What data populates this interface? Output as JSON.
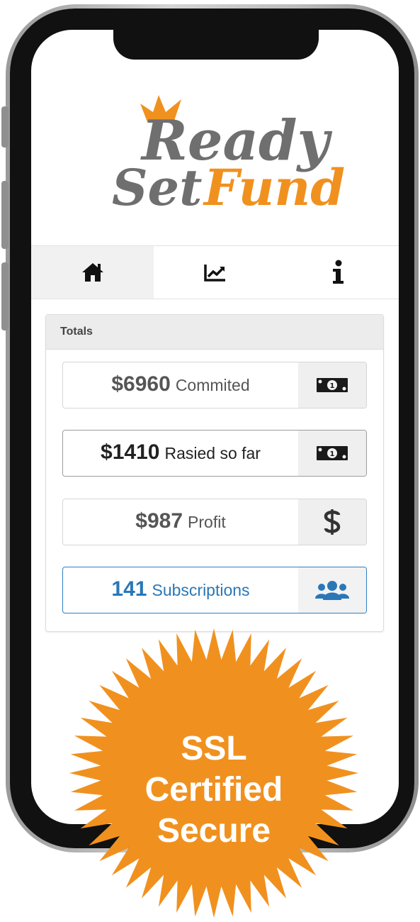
{
  "brand": {
    "word1": "Ready",
    "word2_a": "Set",
    "word2_b": "Fund",
    "accent_color": "#f0911f",
    "gray_color": "#6f6f6f"
  },
  "tabs": [
    {
      "icon": "home-icon",
      "active": true
    },
    {
      "icon": "chart-line-icon",
      "active": false
    },
    {
      "icon": "info-icon",
      "active": false
    }
  ],
  "panel": {
    "title": "Totals",
    "stats": [
      {
        "value": "$6960",
        "label": "Commited",
        "icon": "money-bill-icon"
      },
      {
        "value": "$1410",
        "label": "Rasied so far",
        "icon": "money-bill-icon"
      },
      {
        "value": "$987",
        "label": "Profit",
        "icon": "dollar-icon"
      },
      {
        "value": "141",
        "label": "Subscriptions",
        "icon": "users-icon",
        "color": "#2a77b8"
      }
    ]
  },
  "badge": {
    "line1": "SSL",
    "line2": "Certified",
    "line3": "Secure",
    "color": "#f0911f"
  }
}
